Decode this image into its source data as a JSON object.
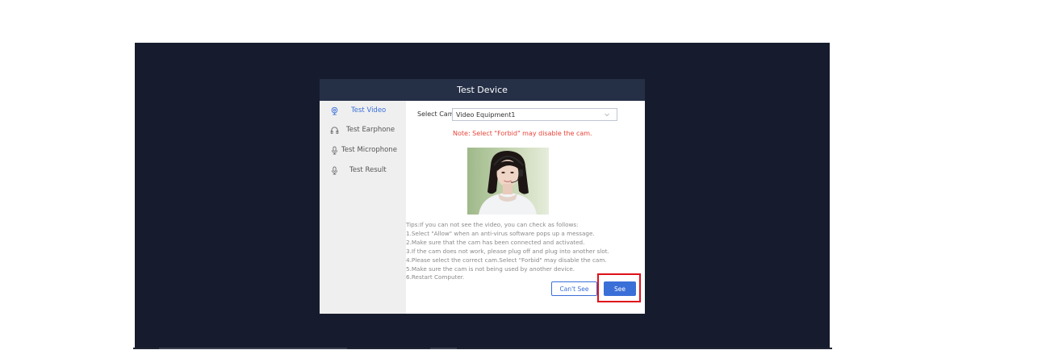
{
  "dialog": {
    "title": "Test Device"
  },
  "sidebar": {
    "items": [
      {
        "label": "Test Video",
        "icon": "webcam-icon",
        "active": true
      },
      {
        "label": "Test Earphone",
        "icon": "headphones-icon",
        "active": false
      },
      {
        "label": "Test Microphone",
        "icon": "microphone-icon",
        "active": false
      },
      {
        "label": "Test Result",
        "icon": "microphone-icon",
        "active": false
      }
    ]
  },
  "main": {
    "select_cam_label": "Select Cam",
    "cam_select_value": "Video Equipment1",
    "note": "Note: Select \"Forbid\" may disable the cam.",
    "preview_image": "webcam-preview-woman-with-headset",
    "tips": [
      "Tips:If you can not see the video, you can check as follows:",
      "1.Select \"Allow\" when an anti-virus software pops up a message.",
      "2.Make sure that the cam has been connected and activated.",
      "3.If the cam does not work, please plug off and plug into another slot.",
      "4.Please select the correct cam.Select \"Forbid\" may disable the cam.",
      "5.Make sure the cam is not being used by another device.",
      "6.Restart Computer."
    ],
    "cant_see_label": "Can't See",
    "see_label": "See"
  },
  "colors": {
    "backdrop": "#161c2d",
    "header": "#253047",
    "accent": "#3b6fd8",
    "note": "#e8443a",
    "highlight": "#e0101a",
    "sidebar": "#efefef"
  }
}
